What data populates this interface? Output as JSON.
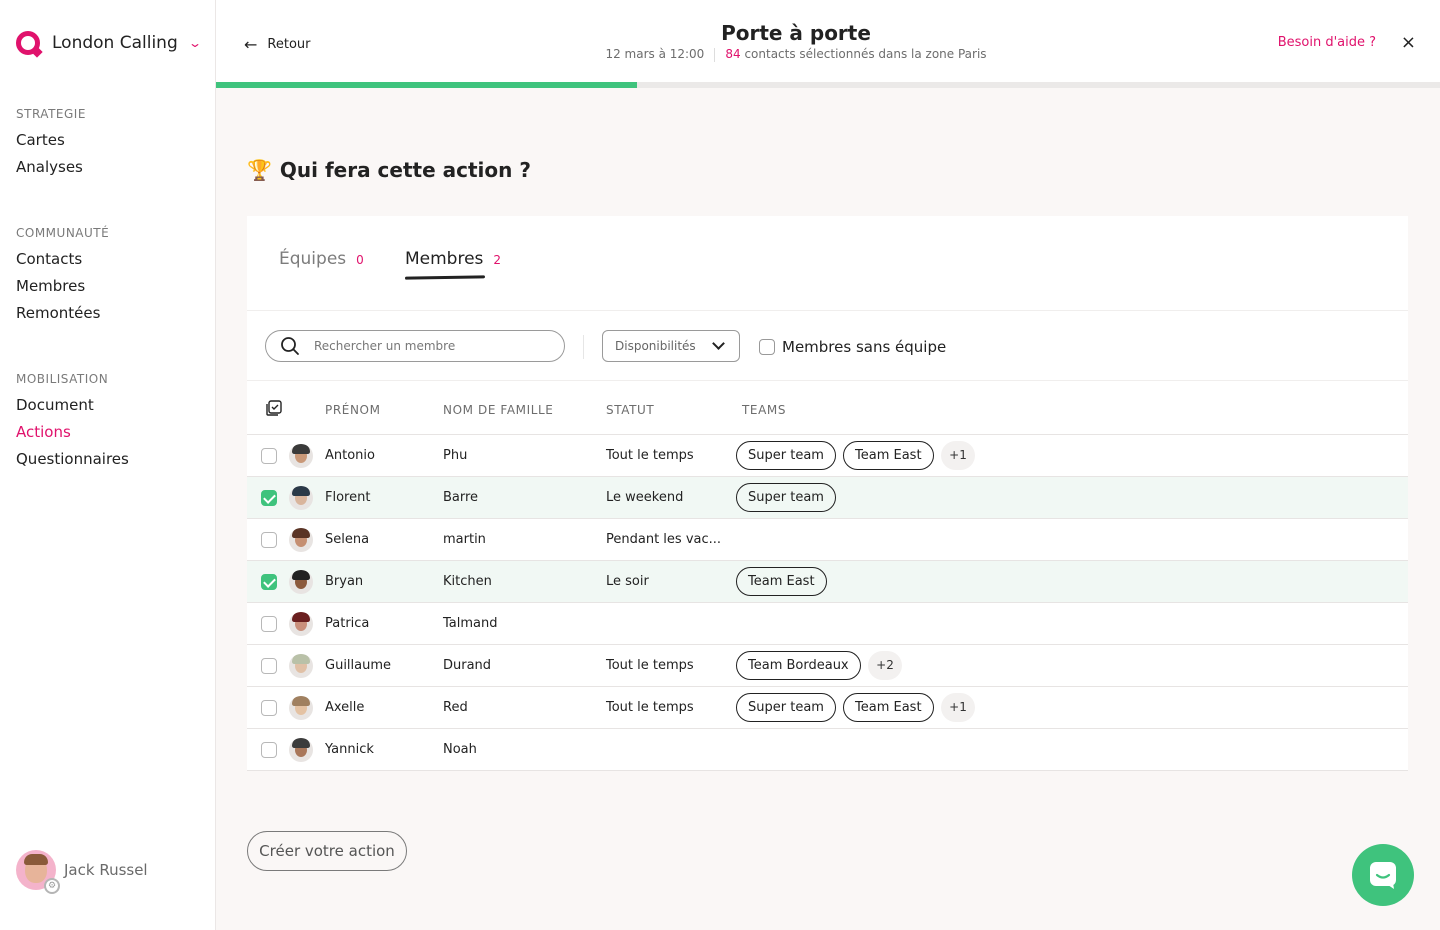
{
  "sidebar": {
    "brand": "London Calling",
    "sections": [
      {
        "heading": "STRATEGIE",
        "items": [
          "Cartes",
          "Analyses"
        ]
      },
      {
        "heading": "COMMUNAUTÉ",
        "items": [
          "Contacts",
          "Membres",
          "Remontées"
        ]
      },
      {
        "heading": "MOBILISATION",
        "items": [
          "Document",
          "Actions",
          "Questionnaires"
        ]
      }
    ],
    "active_item": "Actions",
    "user_name": "Jack Russel"
  },
  "header": {
    "back_label": "Retour",
    "title": "Porte à porte",
    "date": "12 mars à 12:00",
    "contacts_count": "84",
    "contacts_text": "contacts sélectionnés dans la zone Paris",
    "help_label": "Besoin d'aide ?",
    "close_icon": "×"
  },
  "progress": {
    "fraction": 0.344,
    "color": "#3fc37d"
  },
  "question": {
    "icon": "trophy-icon",
    "text": "Qui fera cette action ?"
  },
  "tabs": [
    {
      "label": "Équipes",
      "count": "0"
    },
    {
      "label": "Membres",
      "count": "2"
    }
  ],
  "filters": {
    "search_placeholder": "Rechercher un membre",
    "availability_label": "Disponibilités",
    "no_team_label": "Membres sans équipe"
  },
  "table": {
    "columns": [
      "PRÉNOM",
      "NOM DE FAMILLE",
      "STATUT",
      "TEAMS"
    ],
    "rows": [
      {
        "first": "Antonio",
        "last": "Phu",
        "status": "Tout le temps",
        "teams": [
          "Super team",
          "Team East"
        ],
        "more": "+1",
        "selected": false
      },
      {
        "first": "Florent",
        "last": "Barre",
        "status": "Le weekend",
        "teams": [
          "Super team"
        ],
        "more": "",
        "selected": true
      },
      {
        "first": "Selena",
        "last": "martin",
        "status": "Pendant les vac...",
        "teams": [],
        "more": "",
        "selected": false
      },
      {
        "first": "Bryan",
        "last": "Kitchen",
        "status": "Le soir",
        "teams": [
          "Team East"
        ],
        "more": "",
        "selected": true
      },
      {
        "first": "Patrica",
        "last": "Talmand",
        "status": "",
        "teams": [],
        "more": "",
        "selected": false
      },
      {
        "first": "Guillaume",
        "last": "Durand",
        "status": "Tout le temps",
        "teams": [
          "Team Bordeaux"
        ],
        "more": "+2",
        "selected": false
      },
      {
        "first": "Axelle",
        "last": "Red",
        "status": "Tout le temps",
        "teams": [
          "Super team",
          "Team East"
        ],
        "more": "+1",
        "selected": false
      },
      {
        "first": "Yannick",
        "last": "Noah",
        "status": "",
        "teams": [],
        "more": "",
        "selected": false
      }
    ]
  },
  "create_label": "Créer votre action",
  "colors": {
    "accent": "#e0126c",
    "success": "#3fc37d"
  }
}
